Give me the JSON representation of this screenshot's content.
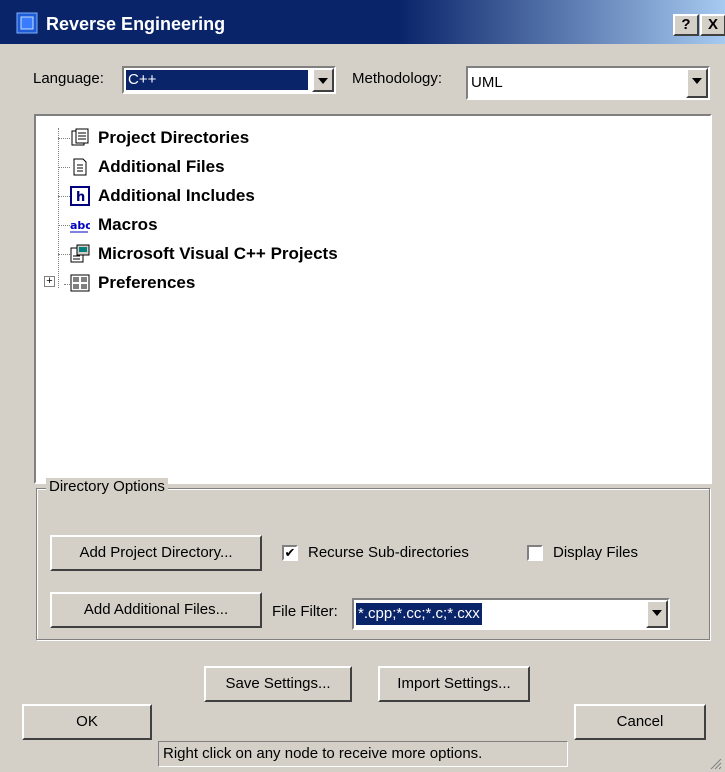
{
  "window": {
    "title": "Reverse Engineering",
    "help_button": "?",
    "close_button": "X"
  },
  "language": {
    "label": "Language:",
    "value": "C++"
  },
  "methodology": {
    "label": "Methodology:",
    "value": "UML"
  },
  "tree": {
    "items": [
      {
        "label": "Project Directories",
        "icon": "project-directories-icon"
      },
      {
        "label": "Additional Files",
        "icon": "file-icon"
      },
      {
        "label": "Additional Includes",
        "icon": "include-icon"
      },
      {
        "label": "Macros",
        "icon": "macros-icon"
      },
      {
        "label": "Microsoft Visual C++ Projects",
        "icon": "vc-project-icon"
      },
      {
        "label": "Preferences",
        "icon": "preferences-icon",
        "expander": "+"
      }
    ]
  },
  "directory_options": {
    "legend": "Directory Options",
    "add_project_directory": "Add Project Directory...",
    "recurse_label": "Recurse Sub-directories",
    "recurse_checked": true,
    "display_files_label": "Display Files",
    "display_files_checked": false,
    "add_additional_files": "Add Additional Files...",
    "file_filter_label": "File Filter:",
    "file_filter_value": "*.cpp;*.cc;*.c;*.cxx"
  },
  "buttons": {
    "save_settings": "Save Settings...",
    "import_settings": "Import Settings...",
    "ok": "OK",
    "cancel": "Cancel"
  },
  "status": {
    "text": "Right click on any node to receive more options."
  },
  "colors": {
    "titlebar": "#0a246a",
    "face": "#d4d0c8",
    "selection": "#0a246a"
  }
}
